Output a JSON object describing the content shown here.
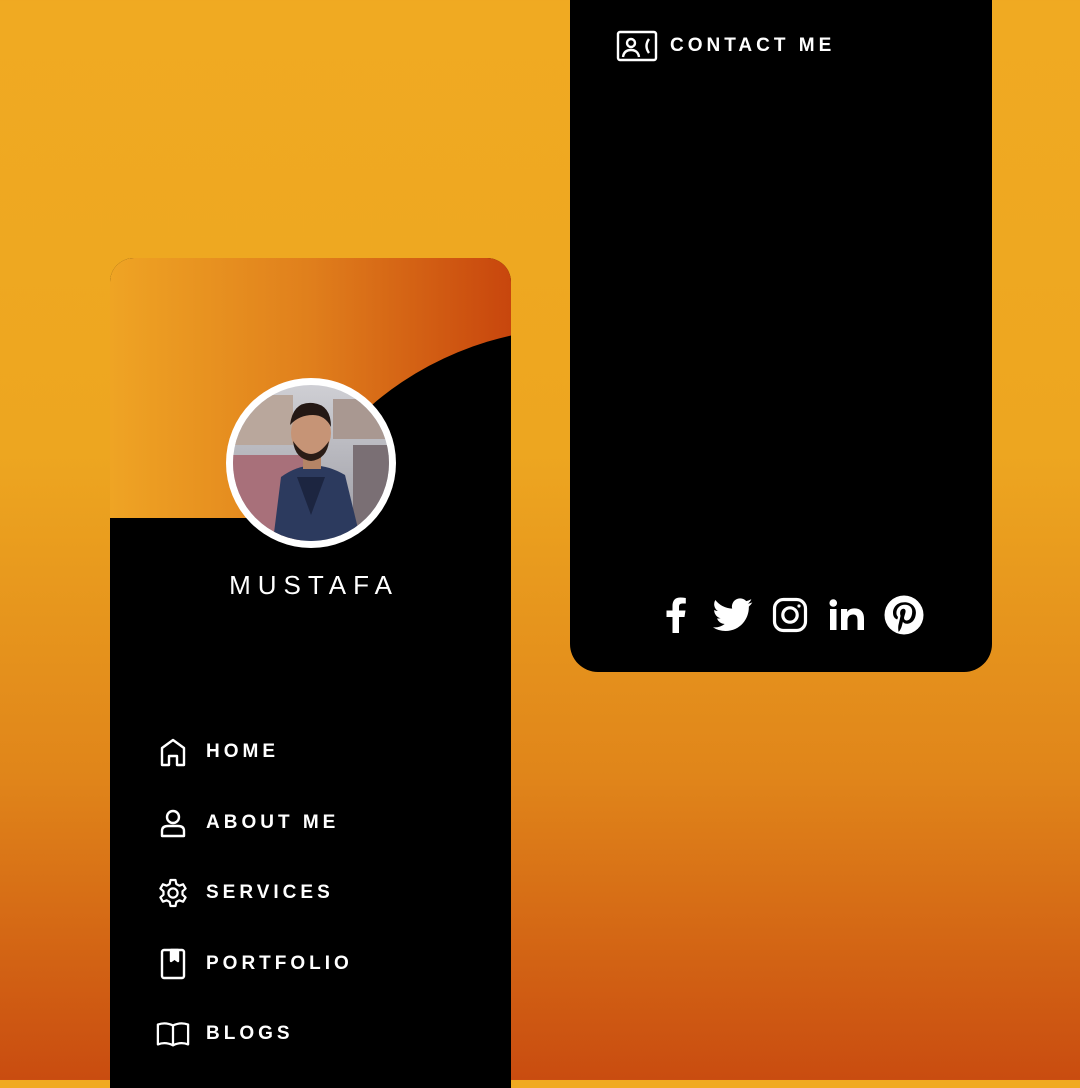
{
  "profile": {
    "name": "MUSTAFA"
  },
  "nav": {
    "items": [
      {
        "label": "HOME",
        "icon": "home-icon"
      },
      {
        "label": "ABOUT ME",
        "icon": "user-icon"
      },
      {
        "label": "SERVICES",
        "icon": "gear-icon"
      },
      {
        "label": "PORTFOLIO",
        "icon": "bookmark-icon"
      },
      {
        "label": "BLOGS",
        "icon": "book-icon"
      }
    ],
    "contact": {
      "label": "CONTACT ME",
      "icon": "contact-card-icon"
    }
  },
  "social": [
    "facebook-icon",
    "twitter-icon",
    "instagram-icon",
    "linkedin-icon",
    "pinterest-icon"
  ],
  "colors": {
    "background_top": "#f0aa22",
    "background_bottom": "#c94c10",
    "card": "#000000",
    "accent_start": "#efa424",
    "accent_end": "#c8460d",
    "text": "#ffffff"
  }
}
